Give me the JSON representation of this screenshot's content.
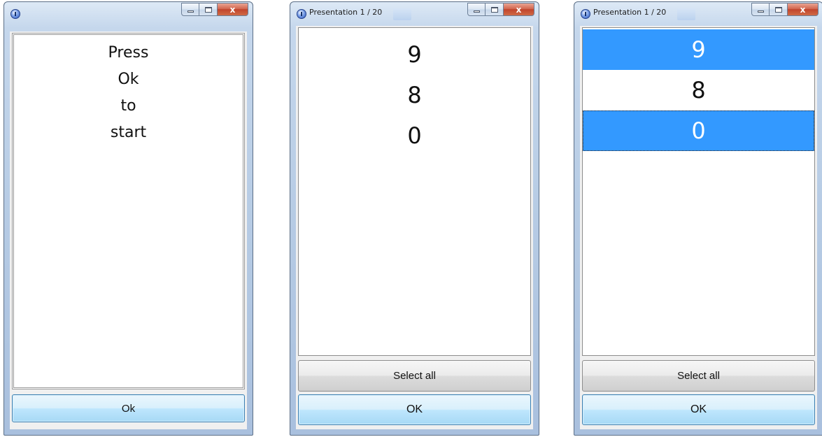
{
  "windows": [
    {
      "id": "start",
      "title": "",
      "prompt_lines": [
        "Press",
        "Ok",
        "to",
        "start"
      ],
      "ok_label": "Ok"
    },
    {
      "id": "presentation-unselected",
      "title": "Presentation 1 / 20",
      "items": [
        {
          "label": "9",
          "selected": false
        },
        {
          "label": "8",
          "selected": false
        },
        {
          "label": "0",
          "selected": false
        }
      ],
      "select_all_label": "Select all",
      "ok_label": "OK"
    },
    {
      "id": "presentation-selected",
      "title": "Presentation 1 / 20",
      "items": [
        {
          "label": "9",
          "selected": true
        },
        {
          "label": "8",
          "selected": false
        },
        {
          "label": "0",
          "selected": true
        }
      ],
      "select_all_label": "Select all",
      "ok_label": "OK"
    }
  ],
  "caption_buttons": {
    "close_glyph": "x"
  },
  "colors": {
    "selection": "#3399ff",
    "ok_button_border": "#3c7fb1"
  }
}
